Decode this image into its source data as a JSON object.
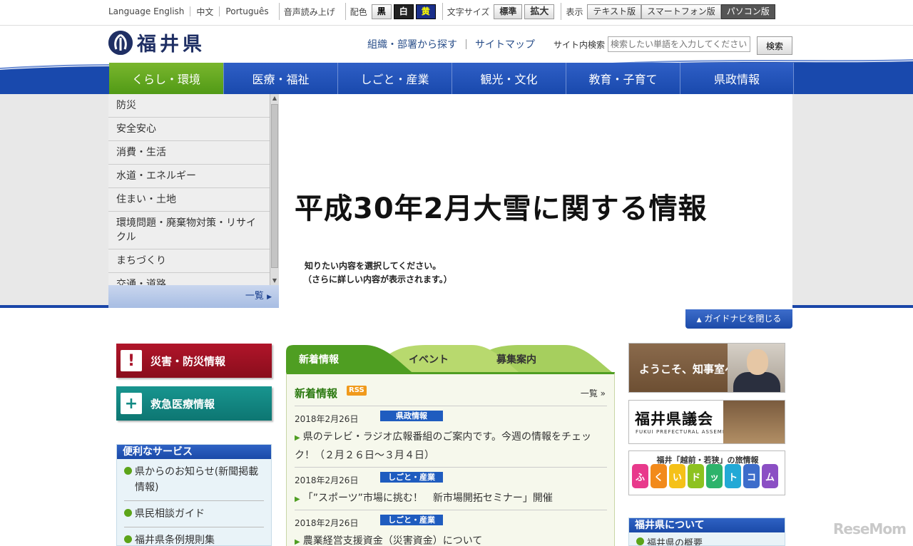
{
  "util": {
    "language_label": "Language",
    "english": "English",
    "chinese": "中文",
    "portuguese": "Português",
    "voice": "音声読み上げ",
    "color_label": "配色",
    "color_black": "黒",
    "color_white": "白",
    "color_yellow": "黄",
    "size_label": "文字サイズ",
    "size_normal": "標準",
    "size_large": "拡大",
    "display_label": "表示",
    "display_text": "テキスト版",
    "display_smartphone": "スマートフォン版",
    "display_pc": "パソコン版"
  },
  "header": {
    "logo_mark": "⌘",
    "site_name": "福井県",
    "link_org": "組織・部署から探す",
    "link_sitemap": "サイトマップ",
    "search_label": "サイト内検索",
    "search_placeholder": "検索したい単語を入力してください",
    "search_button": "検索"
  },
  "nav": {
    "tabs": [
      {
        "label": "くらし・環境"
      },
      {
        "label": "医療・福祉"
      },
      {
        "label": "しごと・産業"
      },
      {
        "label": "観光・文化"
      },
      {
        "label": "教育・子育て"
      },
      {
        "label": "県政情報"
      }
    ]
  },
  "guide": {
    "items": [
      {
        "label": "防災"
      },
      {
        "label": "安全安心"
      },
      {
        "label": "消費・生活"
      },
      {
        "label": "水道・エネルギー"
      },
      {
        "label": "住まい・土地"
      },
      {
        "label": "環境問題・廃棄物対策・リサイクル"
      },
      {
        "label": "まちづくり"
      },
      {
        "label": "交通・道路"
      }
    ],
    "list_all": "一覧",
    "banner_title": "平成30年2月大雪に関する情報",
    "banner_sub1": "知りたい内容を選択してください。",
    "banner_sub2": "（さらに詳しい内容が表示されます。）",
    "close_label": "ガイドナビを閉じる"
  },
  "left": {
    "disaster": "災害・防災情報",
    "emergency": "救急医療情報",
    "services_title": "便利なサービス",
    "services": [
      {
        "label": "県からのお知らせ(新聞掲載情報)"
      },
      {
        "label": "県民相談ガイド"
      },
      {
        "label": "福井県条例規則集"
      }
    ]
  },
  "news": {
    "tab_new": "新着情報",
    "tab_event": "イベント",
    "tab_recruit": "募集案内",
    "title": "新着情報",
    "rss": "RSS",
    "more": "一覧 »",
    "items": [
      {
        "date": "2018年2月26日",
        "category": "県政情報",
        "text": "県のテレビ・ラジオ広報番組のご案内です。今週の情報をチェック！（２月２６日～３月４日）"
      },
      {
        "date": "2018年2月26日",
        "category": "しごと・産業",
        "text": "「”スポーツ”市場に挑む！　新市場開拓セミナー」開催"
      },
      {
        "date": "2018年2月26日",
        "category": "しごと・産業",
        "text": "農業経営支援資金（災害資金）について"
      }
    ]
  },
  "right": {
    "governor": "ようこそ、知事室へ",
    "assembly": "福井県議会",
    "assembly_en": "FUKUI PREFECTURAL ASSEMBLY",
    "tourism_head": "福井「越前・若狭」の旅情報",
    "tourism_chars": [
      "ふ",
      "く",
      "い",
      "ド",
      "ッ",
      "ト",
      "コ",
      "ム"
    ],
    "about_title": "福井県について",
    "about_item": "福井県の概要"
  },
  "watermark": "ReseMom",
  "colors": {
    "nav_blue": "#1949ad",
    "nav_active": "#519a16",
    "disaster_red": "#a9142a",
    "emergency_teal": "#128a84",
    "news_green": "#4f9e22"
  }
}
